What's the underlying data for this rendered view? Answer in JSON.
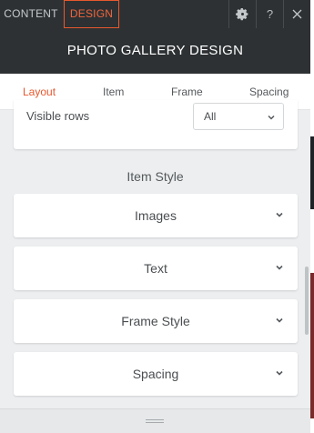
{
  "topbar": {
    "tab_content": "CONTENT",
    "tab_design": "DESIGN",
    "settings_icon": "gear-icon",
    "help_label": "?",
    "close_label": "✕"
  },
  "title": "PHOTO GALLERY DESIGN",
  "nav": {
    "items": [
      "Layout",
      "Item",
      "Frame",
      "Spacing"
    ],
    "active": "Layout",
    "accent_color": "#e8582f"
  },
  "visible_rows": {
    "label": "Visible rows",
    "value": "All"
  },
  "item_style": {
    "title": "Item Style",
    "sections": [
      "Images",
      "Text",
      "Frame Style",
      "Spacing"
    ]
  },
  "colors": {
    "header_bg": "#2d3133",
    "panel_bg": "#eceeef"
  }
}
